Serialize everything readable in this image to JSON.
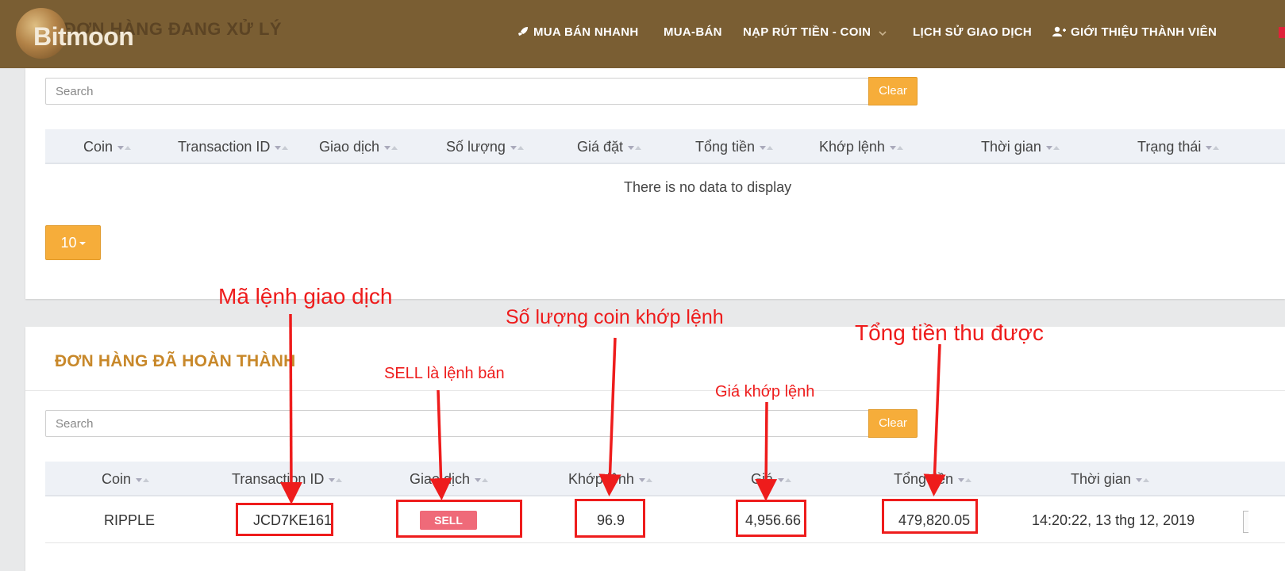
{
  "header": {
    "background_title": "ĐƠN HÀNG ĐANG XỬ LÝ",
    "logo_text": "Bitmoon",
    "nav": [
      {
        "label": "MUA BÁN NHANH",
        "icon": "rocket-icon"
      },
      {
        "label": "MUA-BÁN"
      },
      {
        "label": "NẠP RÚT TIỀN - COIN",
        "icon": "chevron-down-icon"
      },
      {
        "label": "LỊCH SỬ GIAO DỊCH"
      },
      {
        "label": "GIỚI THIỆU THÀNH VIÊN",
        "icon": "user-plus-icon"
      }
    ]
  },
  "pending": {
    "search_placeholder": "Search",
    "clear_label": "Clear",
    "columns": [
      "Coin",
      "Transaction ID",
      "Giao dịch",
      "Số lượng",
      "Giá đặt",
      "Tổng tiền",
      "Khớp lệnh",
      "Thời gian",
      "Trạng thái"
    ],
    "empty_text": "There is no data to display",
    "page_size": "10"
  },
  "completed": {
    "title": "ĐƠN HÀNG ĐÃ HOÀN THÀNH",
    "search_placeholder": "Search",
    "clear_label": "Clear",
    "columns": [
      "Coin",
      "Transaction ID",
      "Giao dịch",
      "Khớp lệnh",
      "Giá",
      "Tổng tiền",
      "Thời gian"
    ],
    "rows": [
      {
        "coin": "RIPPLE",
        "transaction_id": "JCD7KE161",
        "type": "SELL",
        "matched": "96.9",
        "price": "4,956.66",
        "total": "479,820.05",
        "time": "14:20:22, 13 thg 12, 2019"
      }
    ]
  },
  "annotations": {
    "order_code": "Mã lệnh giao dịch",
    "sell_note": "SELL là lệnh bán",
    "matched_amount": "Số lượng coin khớp lệnh",
    "matched_price": "Giá khớp lệnh",
    "total_received": "Tổng tiền thu được"
  },
  "colors": {
    "header": "#7a5e33",
    "accent": "#f6ad3a",
    "section_title": "#c8882a",
    "sell": "#ef6a79",
    "annotation": "#ee1c1c"
  }
}
